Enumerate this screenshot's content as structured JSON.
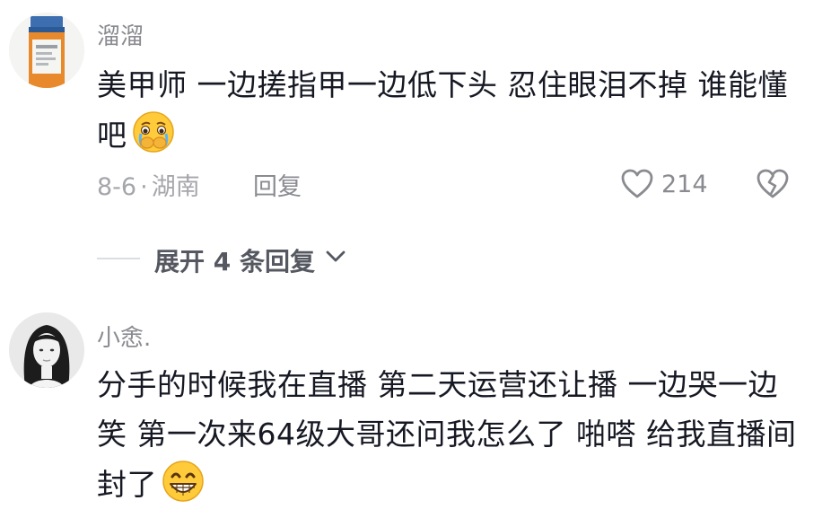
{
  "comments": [
    {
      "username": "溜溜",
      "text": "美甲师 一边搓指甲一边低下头 忍住眼泪不掉 谁能懂吧",
      "emoji": "crying-face-hands-over-mouth",
      "date": "8-6",
      "separator": "·",
      "location": "湖南",
      "reply_label": "回复",
      "likes": "214",
      "expand_label": "展开 4 条回复"
    },
    {
      "username": "小悆.",
      "text": "分手的时候我在直播 第二天运营还让播 一边哭一边笑 第一次来64级大哥还问我怎么了 啪嗒 给我直播间封了",
      "emoji": "grinning-face-with-teeth"
    }
  ],
  "colors": {
    "text": "#161823",
    "username": "#8a8b91",
    "meta": "#a5a6ab",
    "emoji_yellow": "#ffcb3b"
  }
}
